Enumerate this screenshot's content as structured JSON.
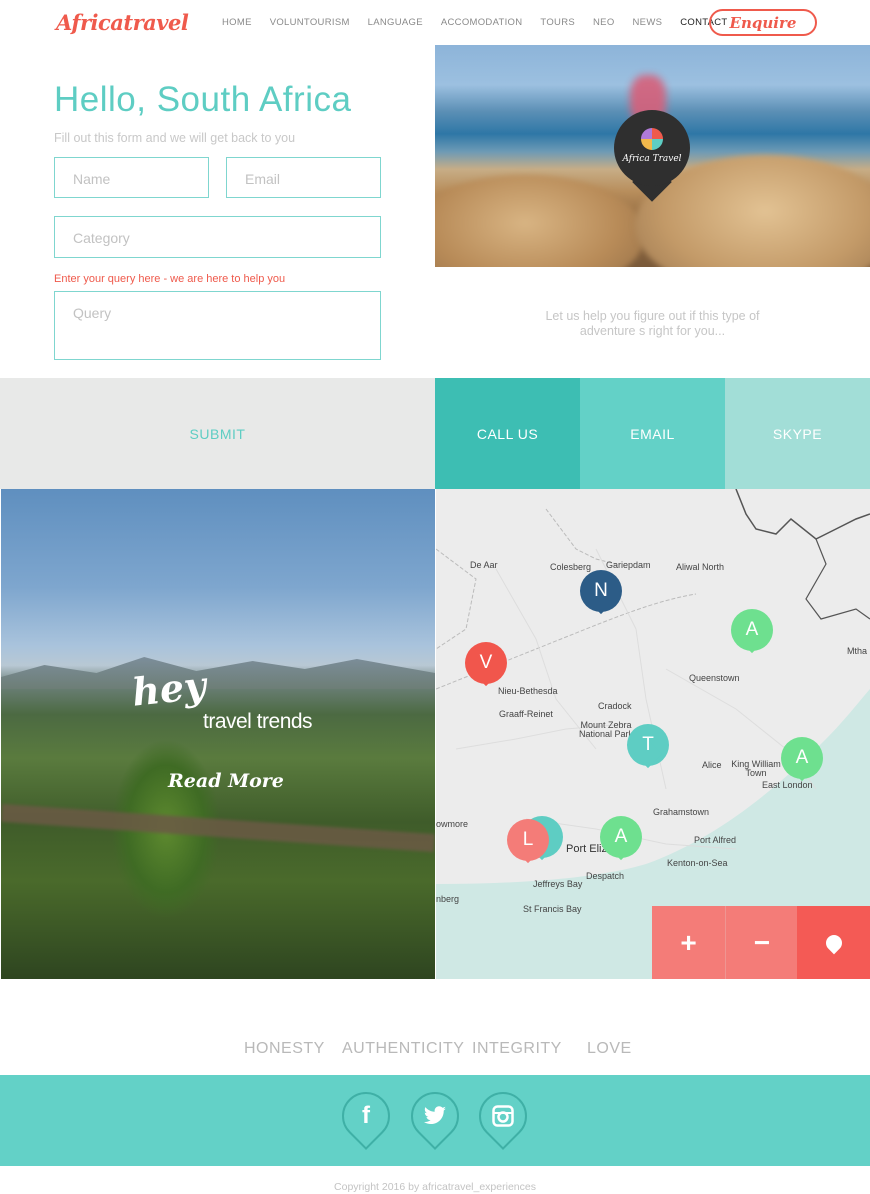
{
  "header": {
    "logo": "Africatravel",
    "nav": [
      "HOME",
      "VOLUNTOURISM",
      "LANGUAGE",
      "ACCOMODATION",
      "TOURS",
      "NEO",
      "NEWS",
      "CONTACT"
    ],
    "active_nav": "CONTACT",
    "enquire_label": "Enquire"
  },
  "form": {
    "title": "Hello, South Africa",
    "subtitle": "Fill out this form and we will get back to you",
    "name_placeholder": "Name",
    "email_placeholder": "Email",
    "category_placeholder": "Category",
    "query_hint": "Enter your query here - we are here to help you",
    "query_placeholder": "Query",
    "submit_label": "SUBMIT"
  },
  "hero": {
    "badge_text": "Africa Travel",
    "help_text": "Let us help you figure out if this type of adventure s right for you..."
  },
  "contact_buttons": {
    "call": "CALL US",
    "email": "EMAIL",
    "skype": "SKYPE"
  },
  "trends": {
    "hey": "hey",
    "label": "travel trends",
    "read_more": "Read More"
  },
  "map": {
    "places": [
      "De Aar",
      "Colesberg",
      "Gariepdam",
      "Aliwal North",
      "Mtha",
      "Queenstown",
      "Nieu-Bethesda",
      "Graaff-Reinet",
      "Cradock",
      "Mount Zebra National Park",
      "Alice",
      "King William Town",
      "East London",
      "Grahamstown",
      "Port Alfred",
      "Kenton-on-Sea",
      "Port Elizabeth",
      "Despatch",
      "Jeffreys Bay",
      "St Francis Bay",
      "owmore",
      "nberg"
    ],
    "pins": [
      {
        "letter": "N",
        "color": "#2c5c87"
      },
      {
        "letter": "A",
        "color": "#6ee08f"
      },
      {
        "letter": "V",
        "color": "#f1564c"
      },
      {
        "letter": "T",
        "color": "#5ecdc3"
      },
      {
        "letter": "A",
        "color": "#6ee08f"
      },
      {
        "letter": "L",
        "color": "#f47c78"
      },
      {
        "letter": "A",
        "color": "#6ee08f"
      }
    ],
    "zoom_in": "+",
    "zoom_out": "−"
  },
  "values": [
    "HONESTY",
    "AUTHENTICITY",
    "INTEGRITY",
    "LOVE"
  ],
  "social": [
    "facebook-icon",
    "twitter-icon",
    "instagram-icon"
  ],
  "copyright": "Copyright 2016 by  africatravel_experiences"
}
